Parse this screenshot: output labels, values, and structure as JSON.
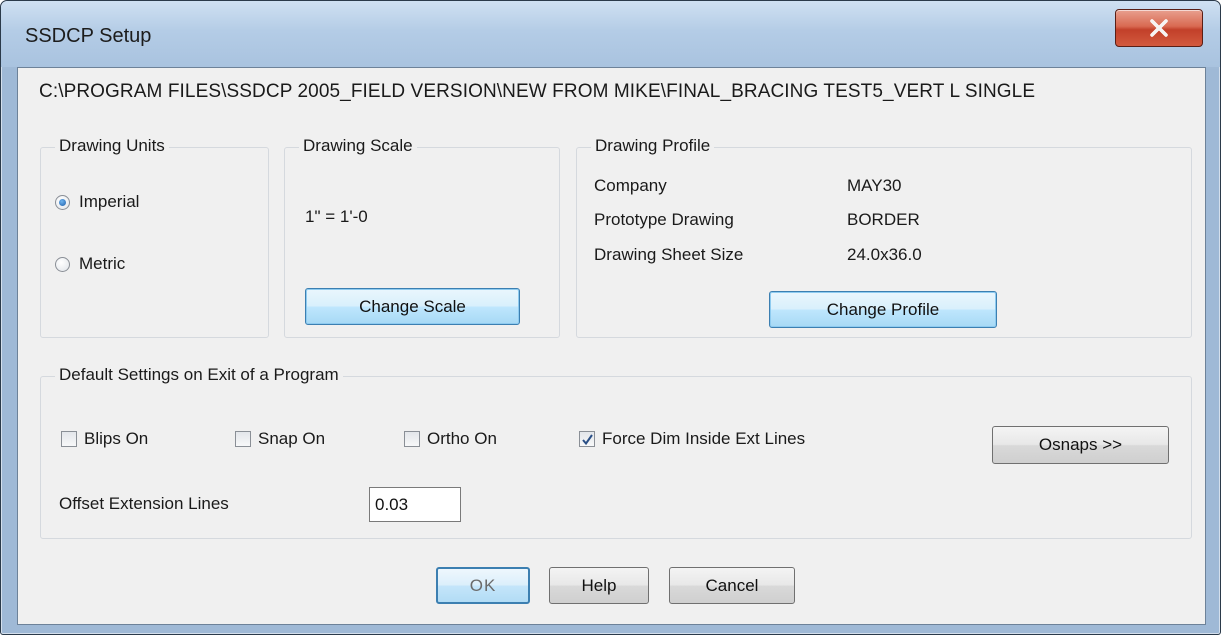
{
  "window": {
    "title": "SSDCP Setup",
    "close_icon": "close-icon"
  },
  "path": "C:\\PROGRAM FILES\\SSDCP 2005_FIELD VERSION\\NEW FROM MIKE\\FINAL_BRACING TEST5_VERT L SINGLE",
  "drawing_units": {
    "label": "Drawing Units",
    "options": [
      {
        "label": "Imperial",
        "checked": true
      },
      {
        "label": "Metric",
        "checked": false
      }
    ]
  },
  "drawing_scale": {
    "label": "Drawing Scale",
    "value": "1\" = 1'-0",
    "button": "Change Scale"
  },
  "drawing_profile": {
    "label": "Drawing Profile",
    "rows": [
      {
        "name": "Company",
        "value": "MAY30"
      },
      {
        "name": "Prototype Drawing",
        "value": "BORDER"
      },
      {
        "name": "Drawing Sheet Size",
        "value": "24.0x36.0"
      }
    ],
    "button": "Change Profile"
  },
  "defaults": {
    "label": "Default Settings on Exit of a Program",
    "checkboxes": [
      {
        "label": "Blips On",
        "checked": false
      },
      {
        "label": "Snap On",
        "checked": false
      },
      {
        "label": "Ortho On",
        "checked": false
      },
      {
        "label": "Force Dim Inside Ext Lines",
        "checked": true
      }
    ],
    "osnaps_button": "Osnaps >>",
    "offset_label": "Offset Extension Lines",
    "offset_value": "0.03"
  },
  "footer": {
    "ok": "OK",
    "help": "Help",
    "cancel": "Cancel"
  },
  "colors": {
    "accent": "#3c7fb1",
    "close_button": "#c2402a"
  }
}
